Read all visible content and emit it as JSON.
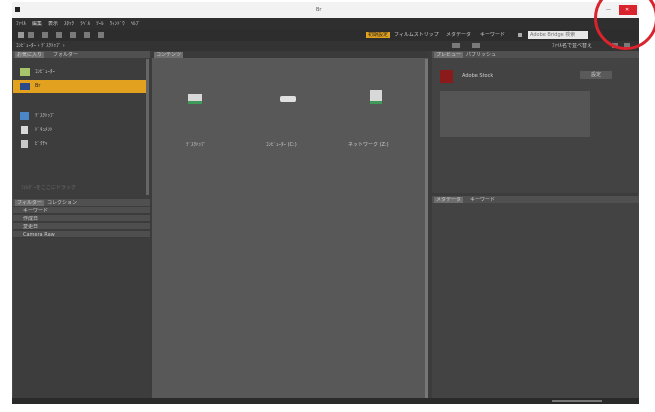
{
  "titlebar": {
    "title": "Br",
    "minimize_label": "—",
    "close_label": "✕"
  },
  "menubar": {
    "items": [
      "ﾌｧｲﾙ",
      "編集",
      "表示",
      "ｽﾀｯｸ",
      "ﾗﾍﾞﾙ",
      "ﾂｰﾙ",
      "ｳｨﾝﾄﾞｳ",
      "ﾍﾙﾌﾟ"
    ]
  },
  "toolbar": {
    "workspace_tabs": [
      "初期設定",
      "フィルムストリップ",
      "メタデータ",
      "キーワード"
    ],
    "search_placeholder": "Adobe Bridge 検索"
  },
  "toolbar2": {
    "path": "ｺﾝﾋﾟｭｰﾀｰ › ﾃﾞｽｸﾄｯﾌﾟ ›",
    "sort_label": "ﾌｧｲﾙ名で並べ替え"
  },
  "left_panel": {
    "tabs": [
      "お気に入り",
      "フォルダー"
    ],
    "items": [
      {
        "label": "ｺﾝﾋﾟｭｰﾀｰ",
        "selected": false
      },
      {
        "label": "Br",
        "selected": true
      },
      {
        "label": "ﾃﾞｽｸﾄｯﾌﾟ",
        "selected": false
      },
      {
        "label": "ﾄﾞｷｭﾒﾝﾄ",
        "selected": false
      },
      {
        "label": "ﾋﾟｸﾁｬ",
        "selected": false
      }
    ],
    "footer": "ﾌｫﾙﾀﾞｰをここにドラッグ"
  },
  "filter_panel": {
    "tabs": [
      "フィルター",
      "コレクション"
    ],
    "rows": [
      "キーワード",
      "作成日",
      "変更日",
      "Camera Raw"
    ]
  },
  "content_panel": {
    "tab": "コンテンツ",
    "items": [
      {
        "label": "ﾃﾞｽｸﾄｯﾌﾟ",
        "icon": "desktop-drive-icon"
      },
      {
        "label": "ｺﾝﾋﾟｭｰﾀｰ (C:)",
        "icon": "hard-drive-icon"
      },
      {
        "label": "ネットワーク (Z:)",
        "icon": "network-drive-icon"
      }
    ]
  },
  "preview_panel": {
    "tabs": [
      "プレビュー",
      "パブリッシュ"
    ],
    "account": "Adobe Stock",
    "button": "設定"
  },
  "metadata_panel": {
    "tabs": [
      "メタデータ",
      "キーワード"
    ]
  },
  "colors": {
    "accent": "#e2a11e",
    "selection": "#e2a11e",
    "panel": "#3c3c3c",
    "close_red": "#d9232d",
    "stock_red": "#8b1a1a"
  }
}
